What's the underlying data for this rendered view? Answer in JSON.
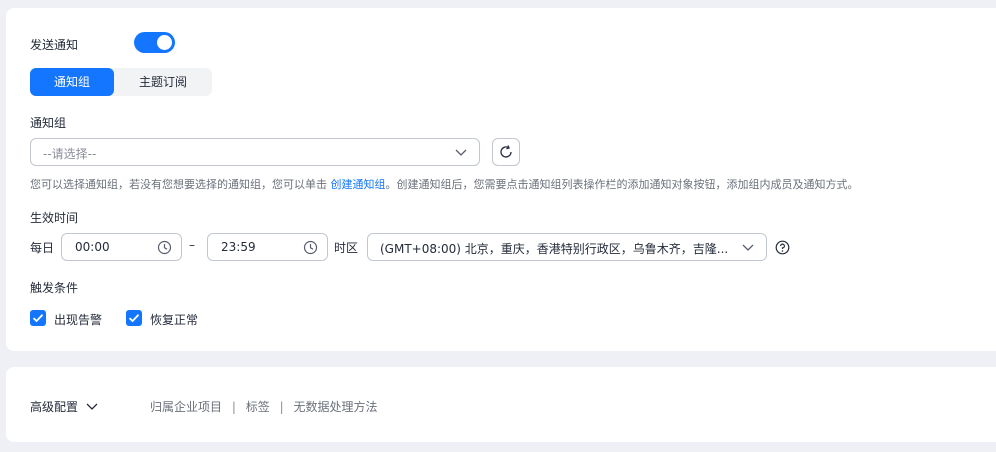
{
  "notify": {
    "send_label": "发送通知",
    "send_enabled": true
  },
  "tabs": [
    {
      "label": "通知组",
      "active": true
    },
    {
      "label": "主题订阅",
      "active": false
    }
  ],
  "group": {
    "label": "通知组",
    "select_placeholder": "--请选择--",
    "hint_before": "您可以选择通知组，若没有您想要选择的通知组，您可以单击 ",
    "hint_link": "创建通知组",
    "hint_after": "。创建通知组后，您需要点击通知组列表操作栏的添加通知对象按钮，添加组内成员及通知方式。"
  },
  "effective_time": {
    "label": "生效时间",
    "prefix": "每日",
    "start": "00:00",
    "dash": "–",
    "end": "23:59",
    "timezone_label": "时区",
    "timezone_value": "(GMT+08:00) 北京，重庆，香港特别行政区，乌鲁木齐，吉隆..."
  },
  "trigger": {
    "label": "触发条件",
    "options": [
      {
        "label": "出现告警",
        "checked": true
      },
      {
        "label": "恢复正常",
        "checked": true
      }
    ]
  },
  "advanced": {
    "label": "高级配置",
    "links": [
      "归属企业项目",
      "标签",
      "无数据处理方法"
    ],
    "separator": "|"
  },
  "colors": {
    "primary": "#1476ff",
    "background": "#eef0f5",
    "border": "#c2c7d0",
    "muted_text": "#6b707a"
  }
}
